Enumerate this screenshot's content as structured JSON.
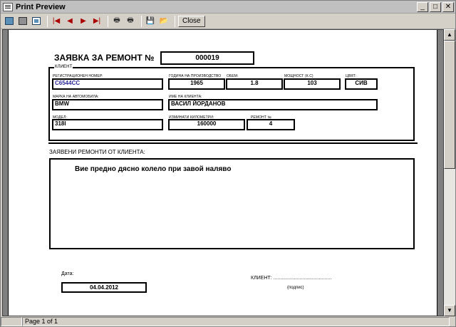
{
  "window": {
    "title": "Print Preview",
    "controls": {
      "minimize": "_",
      "maximize": "□",
      "close": "✕"
    }
  },
  "toolbar": {
    "close_label": "Close",
    "icons": [
      "one-page-icon",
      "two-page-icon",
      "multi-page-icon",
      "first-page-icon",
      "prev-page-icon",
      "next-page-icon",
      "last-page-icon",
      "printer-icon",
      "print-setup-icon",
      "save-icon",
      "open-icon"
    ]
  },
  "report": {
    "title": "ЗАЯВКА ЗА РЕМОНТ №",
    "order_number": "000019",
    "client_group_label": "КЛИЕНТ",
    "fields": {
      "reg_number_label": "РЕГИСТРАЦИОНЕН НОМЕР:",
      "reg_number": "С6544СС",
      "year_label": "ГОДИНА НА ПРОИЗВОДСТВО",
      "year": "1965",
      "volume_label": "ОБЕМ:",
      "volume": "1.8",
      "power_label": "МОЩНОСТ (К.С)",
      "power": "103",
      "color_label": "ЦВЯТ:",
      "color": "СИВ",
      "make_label": "МАРКА НА АВТОМОБИЛА:",
      "make": "BMW",
      "client_name_label": "ИМЕ НА КЛИЕНТА:",
      "client_name": "ВАСИЛ ЙОРДАНОВ",
      "model_label": "МОДЕЛ:",
      "model": "318I",
      "mileage_label": "ИЗМИНАТИ КИЛОМЕТРИ:",
      "mileage": "160000",
      "repair_no_label": "РЕМОНТ №",
      "repair_no": "4"
    },
    "requested_label": "ЗАЯВЕНИ РЕМОНТИ ОТ КЛИЕНТА:",
    "requested_text": "Вие предно дясно колело при завой наляво",
    "date_label": "Дата:",
    "date": "04.04.2012",
    "signature_label": "КЛИЕНТ: ..........................................",
    "signature_caption": "(подпис)"
  },
  "status": {
    "page_info": "Page 1 of 1"
  }
}
